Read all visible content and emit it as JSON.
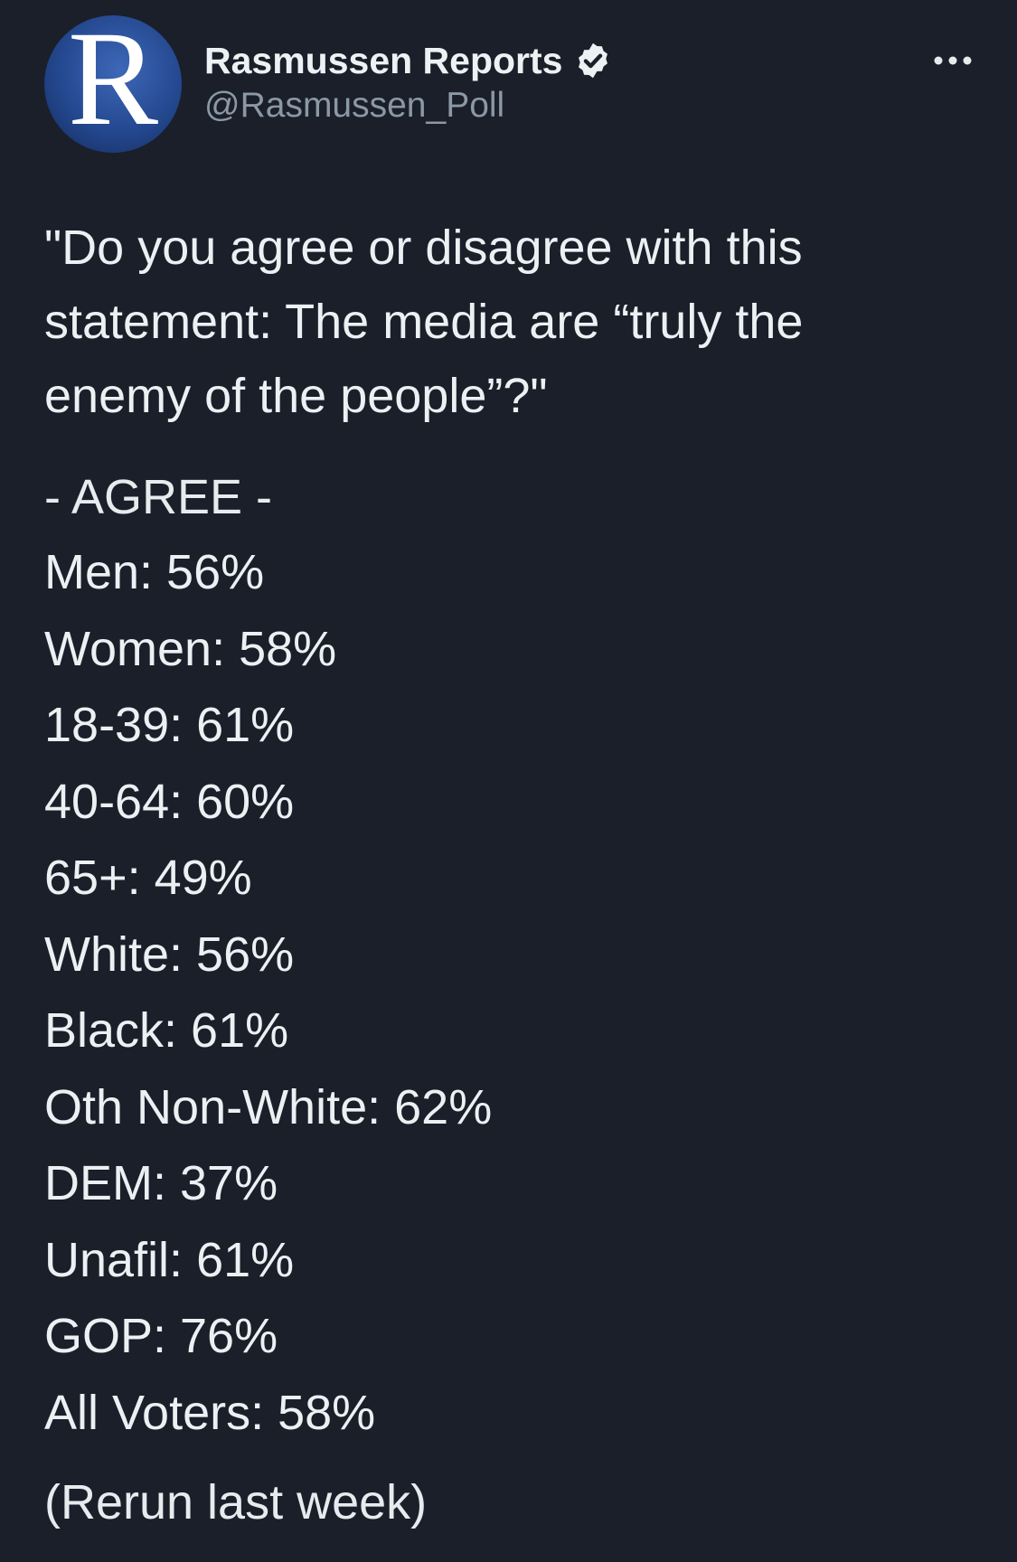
{
  "account": {
    "display_name": "Rasmussen Reports",
    "handle": "@Rasmussen_Poll",
    "avatar_letter": "R",
    "verified_icon": "verified-badge-icon"
  },
  "menu": {
    "icon": "more-options-icon"
  },
  "tweet": {
    "question": "\"Do you agree or disagree with this\nstatement: The media are “truly the\nenemy of the people”?\"",
    "section_title": "- AGREE -",
    "stats": [
      {
        "text": "Men: 56%"
      },
      {
        "text": "Women: 58%"
      },
      {
        "text": "18-39: 61%"
      },
      {
        "text": "40-64: 60%"
      },
      {
        "text": "65+: 49%"
      },
      {
        "text": "White: 56%"
      },
      {
        "text": "Black: 61%"
      },
      {
        "text": "Oth Non-White: 62%"
      },
      {
        "text": "DEM: 37%"
      },
      {
        "text": "Unafil: 61%"
      },
      {
        "text": "GOP: 76%"
      },
      {
        "text": "All Voters: 58%"
      }
    ],
    "footer": "(Rerun last week)"
  },
  "colors": {
    "background": "#1a1f2a",
    "text": "#edf0f3",
    "secondary_text": "#8b98a5",
    "avatar_blue": "#24488f"
  }
}
